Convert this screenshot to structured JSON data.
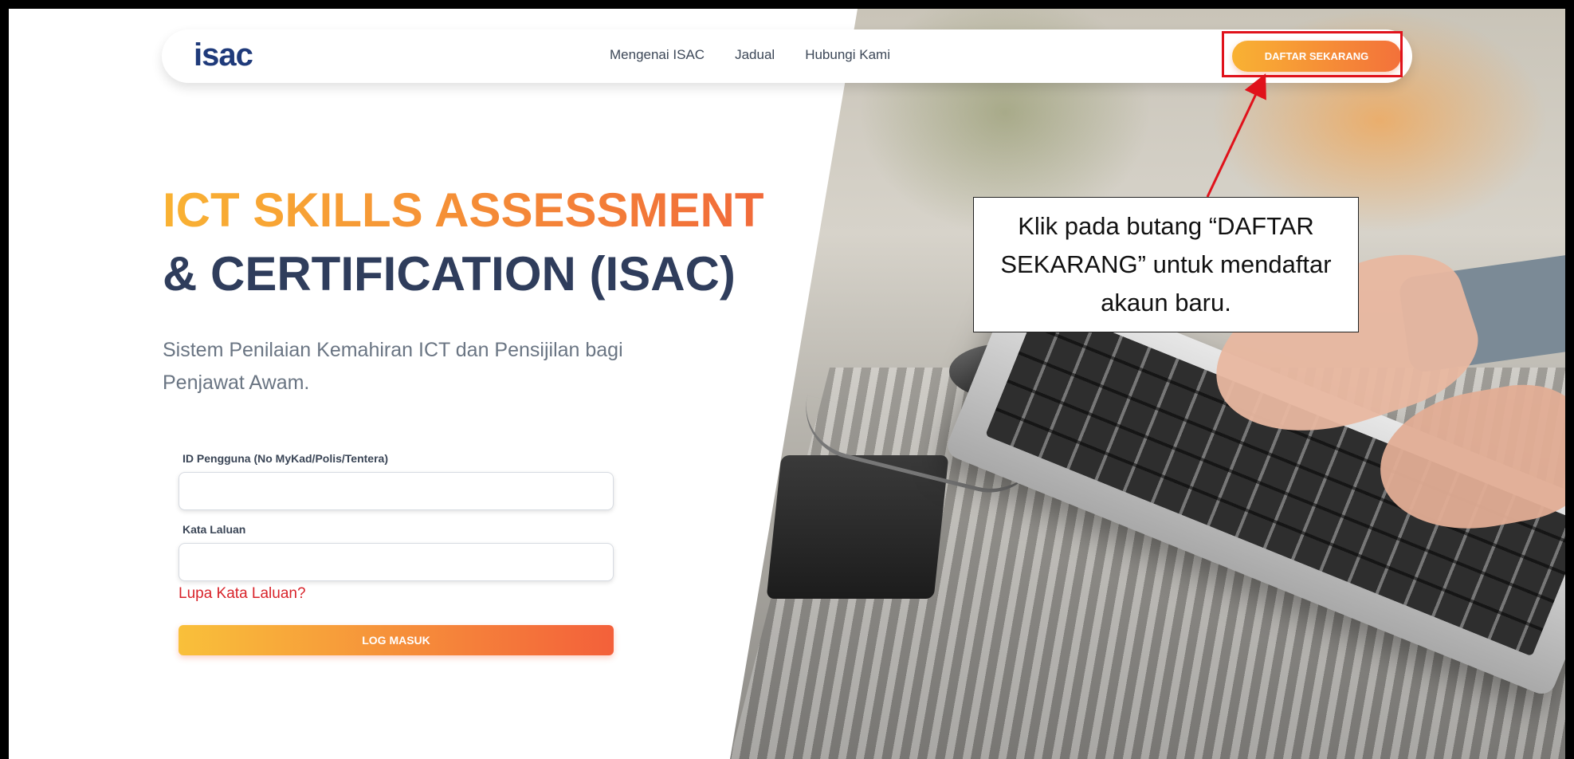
{
  "brand": {
    "logo_text": "isac"
  },
  "nav": {
    "links": [
      "Mengenai ISAC",
      "Jadual",
      "Hubungi Kami"
    ],
    "cta_label": "DAFTAR SEKARANG"
  },
  "hero": {
    "title_line1": "ICT SKILLS ASSESSMENT",
    "title_line2": "& CERTIFICATION (ISAC)",
    "subtitle": "Sistem Penilaian Kemahiran ICT dan Pensijilan bagi Penjawat Awam."
  },
  "form": {
    "user_id_label": "ID Pengguna (No MyKad/Polis/Tentera)",
    "user_id_value": "",
    "password_label": "Kata Laluan",
    "password_value": "",
    "forgot_label": "Lupa Kata Laluan?",
    "login_label": "LOG MASUK"
  },
  "annotation": {
    "text": "Klik pada butang “DAFTAR SEKARANG” untuk mendaftar akaun baru."
  },
  "colors": {
    "accent_orange": "#f9b233",
    "accent_red_orange": "#f3713a",
    "title_navy": "#2f3d5c",
    "annotation_red": "#e0121b",
    "forgot_red": "#d8232a"
  }
}
